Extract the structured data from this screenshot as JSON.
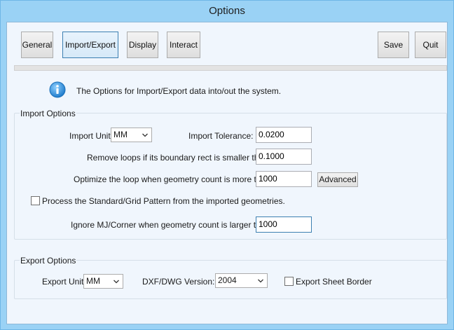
{
  "window": {
    "title": "Options"
  },
  "toolbar": {
    "general": "General",
    "import_export": "Import/Export",
    "display": "Display",
    "interact": "Interact",
    "save": "Save",
    "quit": "Quit",
    "active_tab": "Import/Export"
  },
  "info": {
    "text": "The Options for Import/Export data into/out the system."
  },
  "import_options": {
    "title": "Import Options",
    "import_unit_label": "Import Unit:",
    "import_unit_value": "MM",
    "import_tolerance_label": "Import Tolerance:",
    "import_tolerance_value": "0.0200",
    "remove_loops_label": "Remove loops if its boundary rect is smaller than:",
    "remove_loops_value": "0.1000",
    "optimize_label": "Optimize the loop when geometry count is more than:",
    "optimize_value": "1000",
    "advanced_button": "Advanced",
    "process_pattern_label": "Process the Standard/Grid Pattern from the imported geometries.",
    "process_pattern_checked": false,
    "ignore_mj_label": "Ignore MJ/Corner when geometry count is larger than:",
    "ignore_mj_value": "1000"
  },
  "export_options": {
    "title": "Export Options",
    "export_unit_label": "Export Unit:",
    "export_unit_value": "MM",
    "dxf_version_label": "DXF/DWG Version:",
    "dxf_version_value": "2004",
    "export_border_label": "Export Sheet Border",
    "export_border_checked": false
  },
  "colors": {
    "title_bar": "#9ad2f5",
    "client_bg": "#f0f6fd",
    "info_icon": "#2b8fd8",
    "active_border": "#3c7fb1"
  }
}
